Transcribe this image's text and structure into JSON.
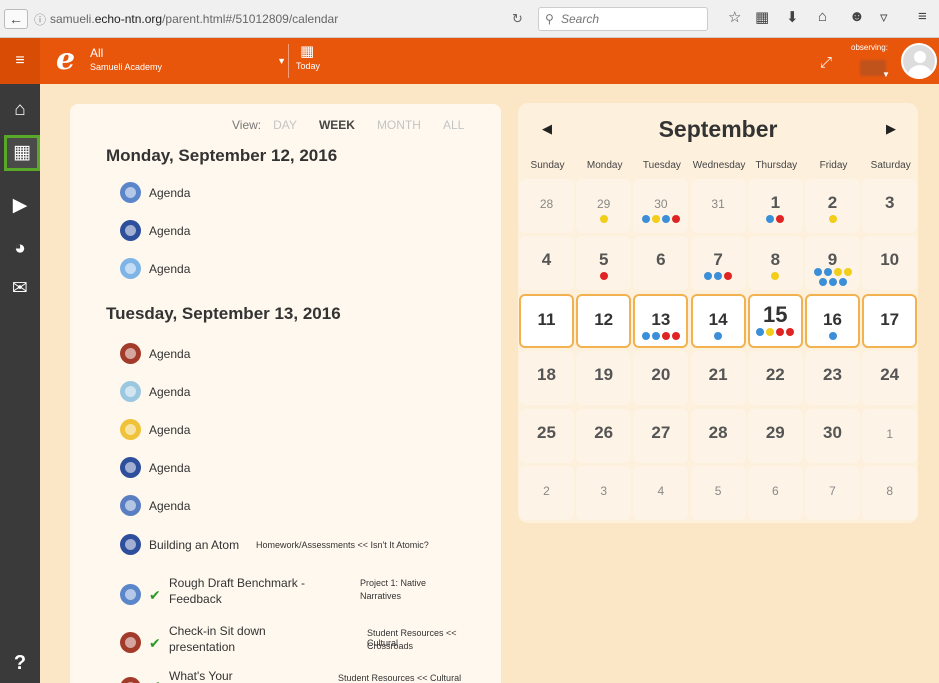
{
  "browser": {
    "url_prefix": "samueli.",
    "url_domain": "echo-ntn.org",
    "url_path": "/parent.html#/51012809/calendar",
    "search_placeholder": "Search"
  },
  "header": {
    "course_line1": "All",
    "course_line2": "Samueli Academy",
    "today_label": "Today",
    "observing_label": "observing:"
  },
  "colors": {
    "brand_orange": "#e8560c",
    "sidebar": "#3a3a3a",
    "active_highlight": "#5aa82a",
    "dot_blue": "#3a8fd8",
    "dot_yellow": "#f2cd1a",
    "dot_red": "#e02424",
    "dot_light_blue": "#6fb7e6"
  },
  "views": {
    "label": "View:",
    "options": [
      "DAY",
      "WEEK",
      "MONTH",
      "ALL"
    ],
    "selected": "WEEK"
  },
  "days": [
    {
      "heading": "Monday, September 12, 2016",
      "items": [
        {
          "icon": "flag-course-icon",
          "color": "#5b86c9",
          "title": "Agenda"
        },
        {
          "icon": "chart-course-icon",
          "color": "#2e4f9b",
          "title": "Agenda"
        },
        {
          "icon": "spanish-course-icon",
          "color": "#7eb4e6",
          "title": "Agenda"
        }
      ]
    },
    {
      "heading": "Tuesday, September 13, 2016",
      "items": [
        {
          "icon": "soccer-course-icon",
          "color": "#a33b2b",
          "title": "Agenda"
        },
        {
          "icon": "network-course-icon",
          "color": "#9cc7e0",
          "title": "Agenda"
        },
        {
          "icon": "puzzle-course-icon",
          "color": "#f0c23a",
          "title": "Agenda"
        },
        {
          "icon": "chart-course-icon",
          "color": "#2e4f9b",
          "title": "Agenda"
        },
        {
          "icon": "school-course-icon",
          "color": "#5a7ec2",
          "title": "Agenda"
        },
        {
          "icon": "chart-course-icon",
          "color": "#2e4f9b",
          "title": "Building an Atom",
          "sub": "Homework/Assessments << Isn't It Atomic?"
        },
        {
          "icon": "flag-course-icon",
          "color": "#5b86c9",
          "check": true,
          "title1": "Rough Draft Benchmark -",
          "title2": "Feedback",
          "sub1": "Project 1: Native",
          "sub2": "Narratives"
        },
        {
          "icon": "soccer-course-icon",
          "color": "#a33b2b",
          "check": true,
          "title1": "Check-in Sit down",
          "title2": "presentation",
          "sub1": "Student Resources << Cultural",
          "sub2": "Crossroads"
        },
        {
          "icon": "soccer-course-icon",
          "color": "#a33b2b",
          "check": true,
          "title1": "What's Your",
          "sub1": "Student Resources << Cultural"
        }
      ]
    }
  ],
  "calendar": {
    "month": "September",
    "weekdays": [
      "Sunday",
      "Monday",
      "Tuesday",
      "Wednesday",
      "Thursday",
      "Friday",
      "Saturday"
    ],
    "weeks": [
      [
        {
          "d": "28",
          "o": true
        },
        {
          "d": "29",
          "o": true,
          "dots": [
            [
              "yellow"
            ]
          ]
        },
        {
          "d": "30",
          "o": true,
          "dots": [
            [
              "blue",
              "yellow",
              "blue",
              "red"
            ]
          ]
        },
        {
          "d": "31",
          "o": true
        },
        {
          "d": "1",
          "dots": [
            [
              "blue",
              "red"
            ]
          ]
        },
        {
          "d": "2",
          "dots": [
            [
              "yellow"
            ]
          ]
        },
        {
          "d": "3"
        }
      ],
      [
        {
          "d": "4"
        },
        {
          "d": "5",
          "dots": [
            [
              "red"
            ]
          ]
        },
        {
          "d": "6"
        },
        {
          "d": "7",
          "dots": [
            [
              "blue",
              "blue",
              "red"
            ]
          ]
        },
        {
          "d": "8",
          "dots": [
            [
              "yellow"
            ]
          ]
        },
        {
          "d": "9",
          "dots": [
            [
              "blue",
              "blue",
              "yellow",
              "yellow"
            ],
            [
              "blue",
              "blue",
              "blue"
            ]
          ]
        },
        {
          "d": "10"
        }
      ],
      [
        {
          "d": "11",
          "cur": true
        },
        {
          "d": "12",
          "cur": true
        },
        {
          "d": "13",
          "cur": true,
          "dots": [
            [
              "blue",
              "blue",
              "red",
              "red"
            ]
          ]
        },
        {
          "d": "14",
          "cur": true,
          "dots": [
            [
              "blue"
            ]
          ]
        },
        {
          "d": "15",
          "cur": true,
          "today": true,
          "dots": [
            [
              "blue",
              "yellow",
              "red",
              "red"
            ]
          ]
        },
        {
          "d": "16",
          "cur": true,
          "dots": [
            [
              "blue"
            ]
          ]
        },
        {
          "d": "17",
          "cur": true
        }
      ],
      [
        {
          "d": "18"
        },
        {
          "d": "19"
        },
        {
          "d": "20"
        },
        {
          "d": "21"
        },
        {
          "d": "22"
        },
        {
          "d": "23"
        },
        {
          "d": "24"
        }
      ],
      [
        {
          "d": "25"
        },
        {
          "d": "26"
        },
        {
          "d": "27"
        },
        {
          "d": "28"
        },
        {
          "d": "29"
        },
        {
          "d": "30"
        },
        {
          "d": "1",
          "o": true
        }
      ],
      [
        {
          "d": "2",
          "o": true
        },
        {
          "d": "3",
          "o": true
        },
        {
          "d": "4",
          "o": true
        },
        {
          "d": "5",
          "o": true
        },
        {
          "d": "6",
          "o": true
        },
        {
          "d": "7",
          "o": true
        },
        {
          "d": "8",
          "o": true
        }
      ]
    ]
  }
}
